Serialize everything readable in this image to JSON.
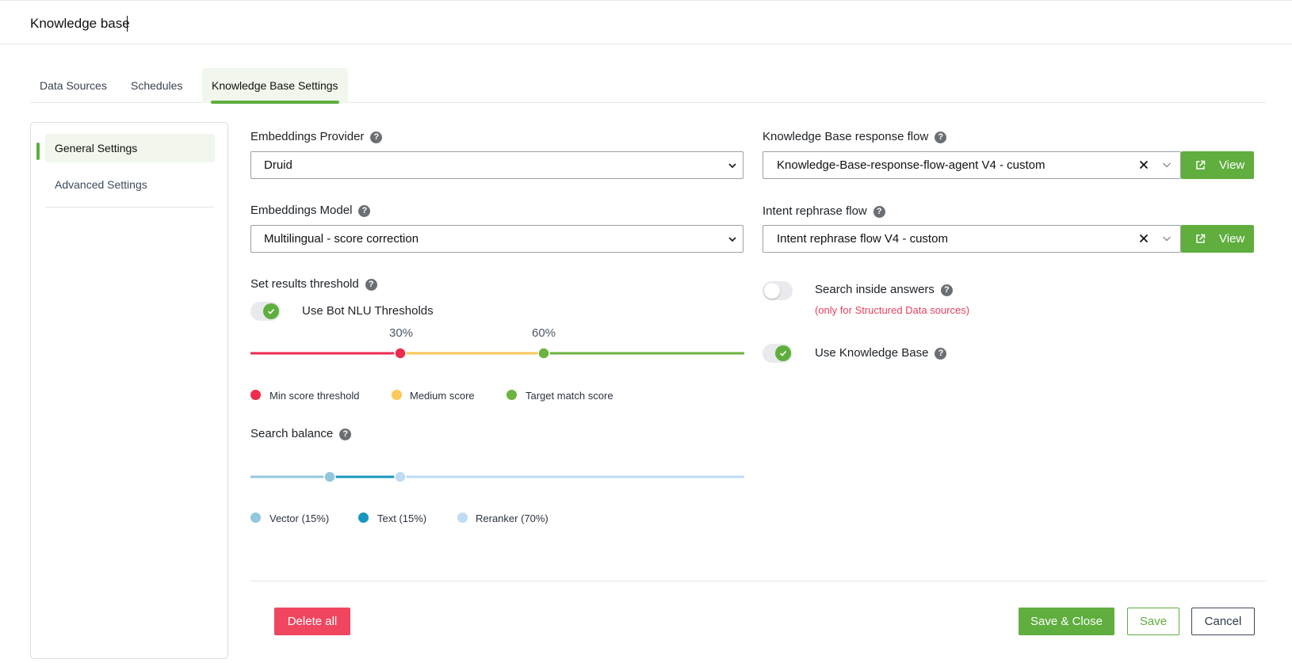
{
  "header": {
    "title": "Knowledge base"
  },
  "tabs": [
    {
      "label": "Data Sources"
    },
    {
      "label": "Schedules"
    },
    {
      "label": "Knowledge Base Settings",
      "active": true
    }
  ],
  "sidebar": {
    "items": [
      {
        "label": "General Settings",
        "active": true
      },
      {
        "label": "Advanced Settings"
      }
    ]
  },
  "embeddings_provider": {
    "label": "Embeddings Provider",
    "value": "Druid"
  },
  "embeddings_model": {
    "label": "Embeddings Model",
    "value": "Multilingual - score correction"
  },
  "threshold": {
    "label": "Set results threshold",
    "use_bot_nlu": {
      "label": "Use Bot NLU Thresholds",
      "enabled": true
    },
    "min_pct": "30%",
    "target_pct": "60%",
    "legend": [
      {
        "label": "Min score threshold",
        "color": "#ee2c4e"
      },
      {
        "label": "Medium score",
        "color": "#fcc859"
      },
      {
        "label": "Target match score",
        "color": "#6db33f"
      }
    ]
  },
  "search_balance": {
    "label": "Search balance",
    "legend": [
      {
        "label": "Vector (15%)",
        "color": "#93c7dd"
      },
      {
        "label": "Text (15%)",
        "color": "#1797c0"
      },
      {
        "label": "Reranker (70%)",
        "color": "#bedcf5"
      }
    ]
  },
  "kb_response_flow": {
    "label": "Knowledge Base response flow",
    "value": "Knowledge-Base-response-flow-agent V4 - custom",
    "view_label": "View"
  },
  "intent_rephrase_flow": {
    "label": "Intent rephrase flow",
    "value": "Intent rephrase flow V4 - custom",
    "view_label": "View"
  },
  "search_inside_answers": {
    "label": "Search inside answers",
    "note": "(only for Structured Data sources)",
    "enabled": false
  },
  "use_knowledge_base": {
    "label": "Use Knowledge Base",
    "enabled": true
  },
  "actions": {
    "delete_all": "Delete all",
    "save_close": "Save & Close",
    "save": "Save",
    "cancel": "Cancel"
  },
  "help_glyph": "?"
}
